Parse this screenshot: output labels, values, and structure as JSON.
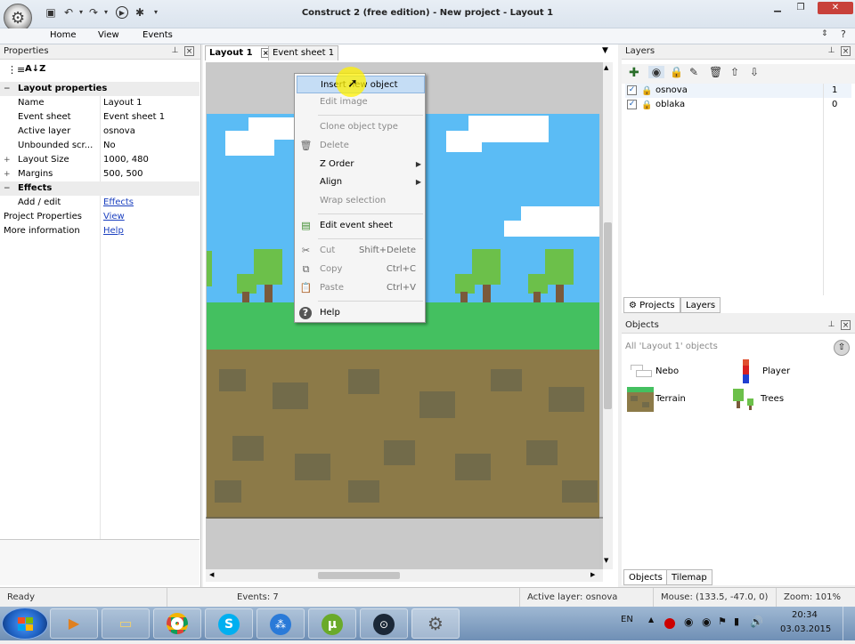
{
  "window": {
    "title": "Construct 2 (free edition) - New project - Layout 1",
    "controls": [
      "minimize",
      "maximize",
      "close"
    ]
  },
  "quick_access": [
    "save-icon",
    "undo-icon",
    "redo-icon",
    "run-icon",
    "debug-icon",
    "dropdown-icon"
  ],
  "ribbon": {
    "tabs": [
      "Home",
      "View",
      "Events"
    ]
  },
  "properties": {
    "title": "Properties",
    "rows": [
      {
        "type": "category",
        "label": "Layout properties",
        "expander": "−"
      },
      {
        "key": "Name",
        "value": "Layout 1"
      },
      {
        "key": "Event sheet",
        "value": "Event sheet 1"
      },
      {
        "key": "Active layer",
        "value": "osnova"
      },
      {
        "key": "Unbounded scr...",
        "value": "No"
      },
      {
        "key": "Layout Size",
        "value": "1000, 480",
        "expander": "+"
      },
      {
        "key": "Margins",
        "value": "500, 500",
        "expander": "+"
      },
      {
        "type": "category",
        "label": "Effects",
        "expander": "−"
      },
      {
        "key": "Add / edit",
        "value": "Effects",
        "link": true
      },
      {
        "key": "Project Properties",
        "value": "View",
        "link": true,
        "top_level": true
      },
      {
        "key": "More information",
        "value": "Help",
        "link": true,
        "top_level": true
      }
    ]
  },
  "editor": {
    "tabs": [
      {
        "label": "Layout 1",
        "active": true
      },
      {
        "label": "Event sheet 1",
        "active": false
      }
    ]
  },
  "context_menu": {
    "items": [
      {
        "label": "Insert new object",
        "icon": "",
        "disabled": false,
        "highlighted": true
      },
      {
        "label": "Edit image",
        "icon": "",
        "disabled": true
      },
      {
        "separator": true
      },
      {
        "label": "Clone object type",
        "icon": "",
        "disabled": true
      },
      {
        "label": "Delete",
        "icon": "trash-icon",
        "disabled": true
      },
      {
        "label": "Z Order",
        "icon": "",
        "disabled": false,
        "submenu": true
      },
      {
        "label": "Align",
        "icon": "",
        "disabled": false,
        "submenu": true
      },
      {
        "label": "Wrap selection",
        "icon": "",
        "disabled": true
      },
      {
        "separator": true
      },
      {
        "label": "Edit event sheet",
        "icon": "event-sheet-icon",
        "disabled": false
      },
      {
        "separator": true
      },
      {
        "label": "Cut",
        "icon": "scissors-icon",
        "shortcut": "Shift+Delete",
        "disabled": true
      },
      {
        "label": "Copy",
        "icon": "copy-icon",
        "shortcut": "Ctrl+C",
        "disabled": true
      },
      {
        "label": "Paste",
        "icon": "paste-icon",
        "shortcut": "Ctrl+V",
        "disabled": true
      },
      {
        "separator": true
      },
      {
        "label": "Help",
        "icon": "help-icon",
        "disabled": false
      }
    ]
  },
  "layers": {
    "title": "Layers",
    "toolbar": [
      "add-layer-icon",
      "eye-icon",
      "lock-icon",
      "edit-icon",
      "delete-icon",
      "move-up-icon",
      "move-down-icon"
    ],
    "rows": [
      {
        "name": "osnova",
        "index": "1",
        "checked": true,
        "selected": true
      },
      {
        "name": "oblaka",
        "index": "0",
        "checked": true,
        "selected": false
      }
    ],
    "bottom_tabs": [
      "Projects",
      "Layers"
    ]
  },
  "objects": {
    "title": "Objects",
    "filter": "All 'Layout 1' objects",
    "items": [
      {
        "name": "Nebo",
        "icon": "cloud-sprite-icon"
      },
      {
        "name": "Player",
        "icon": "player-sprite-icon"
      },
      {
        "name": "Terrain",
        "icon": "terrain-sprite-icon"
      },
      {
        "name": "Trees",
        "icon": "trees-sprite-icon"
      }
    ],
    "bottom_tabs": [
      "Objects",
      "Tilemap"
    ]
  },
  "statusbar": {
    "ready": "Ready",
    "events": "Events: 7",
    "active_layer": "Active layer: osnova",
    "mouse": "Mouse: (133.5, -47.0, 0)",
    "zoom": "Zoom: 101%"
  },
  "taskbar": {
    "apps": [
      "windows-start-icon",
      "media-player-icon",
      "file-explorer-icon",
      "chrome-icon",
      "skype-icon",
      "app-circles-icon",
      "utorrent-icon",
      "steam-icon",
      "construct2-icon"
    ],
    "language": "EN",
    "time": "20:34",
    "date": "03.03.2015"
  },
  "colors": {
    "sky": "#5bbcf5",
    "grass": "#44c060",
    "dirt": "#8c7a48",
    "dirt_block": "#726b4a",
    "tree": "#6cc04a",
    "trunk": "#7a5a3b",
    "cloud": "#ffffff",
    "menu_highlight": "#c5ddf5"
  }
}
